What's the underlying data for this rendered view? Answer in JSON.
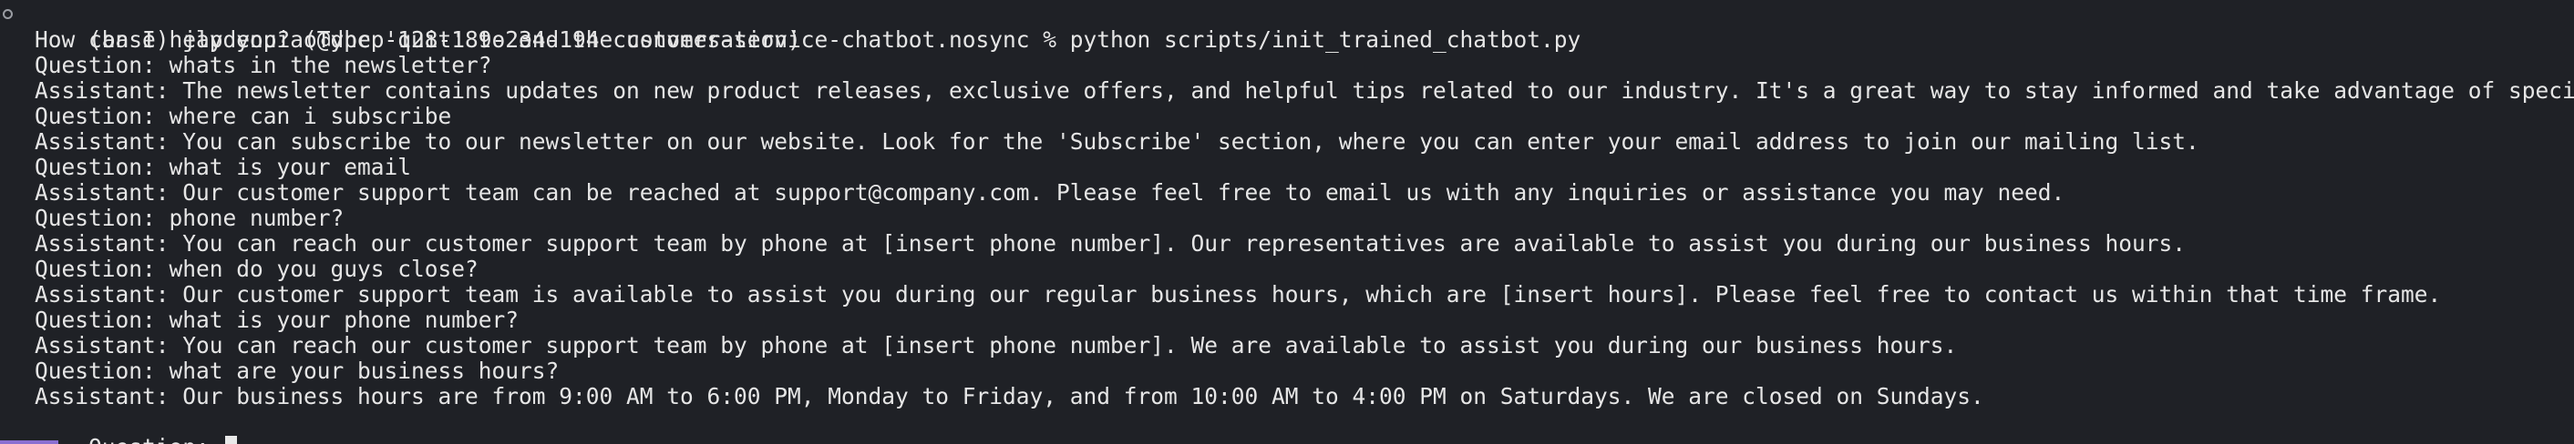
{
  "terminal": {
    "prompt_line": "(base) jaydenpiao@dhcp-128-189-234-194 customer-service-chatbot.nosync % python scripts/init_trained_chatbot.py",
    "lines": [
      "How can I help you? (Type 'quit' to end the conversation)",
      "Question: whats in the newsletter?",
      "Assistant: The newsletter contains updates on new product releases, exclusive offers, and helpful tips related to our industry. It's a great way to stay informed and take advantage of special deals.",
      "Question: where can i subscribe",
      "Assistant: You can subscribe to our newsletter on our website. Look for the 'Subscribe' section, where you can enter your email address to join our mailing list.",
      "Question: what is your email",
      "Assistant: Our customer support team can be reached at support@company.com. Please feel free to email us with any inquiries or assistance you may need.",
      "Question: phone number?",
      "Assistant: You can reach our customer support team by phone at [insert phone number]. Our representatives are available to assist you during our business hours.",
      "Question: when do you guys close?",
      "Assistant: Our customer support team is available to assist you during our regular business hours, which are [insert hours]. Please feel free to contact us within that time frame.",
      "Question: what is your phone number?",
      "Assistant: You can reach our customer support team by phone at [insert phone number]. We are available to assist you during our business hours.",
      "Question: what are your business hours?",
      "Assistant: Our business hours are from 9:00 AM to 6:00 PM, Monday to Friday, and from 10:00 AM to 4:00 PM on Saturdays. We are closed on Sundays."
    ],
    "input_prompt": "Question: ",
    "input_value": "",
    "colors": {
      "background": "#1f2126",
      "text": "#e6e6e6",
      "cursor": "#e9e9e9",
      "accent": "#8a6fd1"
    }
  }
}
